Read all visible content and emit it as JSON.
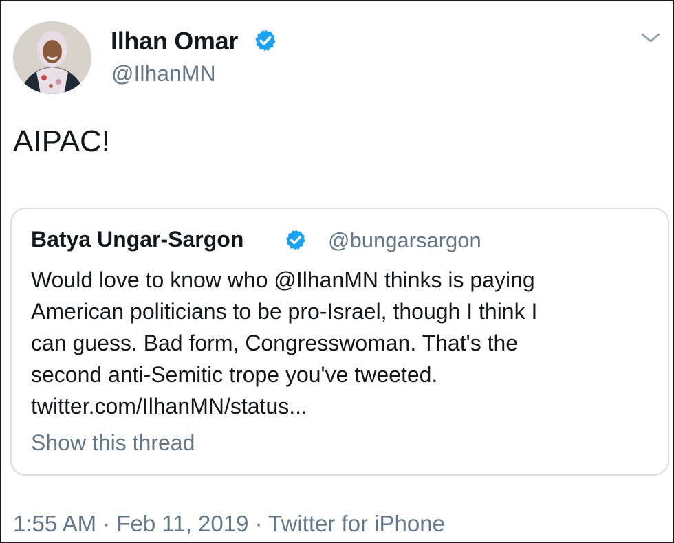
{
  "tweet": {
    "author_name": "Ilhan Omar",
    "author_handle": "@IlhanMN",
    "text": "AIPAC!",
    "meta": "1:55 AM · Feb 11, 2019 · Twitter for iPhone"
  },
  "quoted_tweet": {
    "author_name": "Batya Ungar-Sargon",
    "author_handle": "@bungarsargon",
    "lines": [
      "Would love to know who @IlhanMN thinks is paying",
      "American politicians to be pro-Israel, though I think I",
      "can guess. Bad form, Congresswoman. That's the",
      "second anti-Semitic trope you've tweeted.",
      "twitter.com/IlhanMN/status..."
    ],
    "thread_link": "Show this thread"
  },
  "icons": {
    "verified": "verified-badge-icon",
    "menu": "chevron-down-icon"
  },
  "colors": {
    "accent": "#1da1f2",
    "secondary_text": "#657786",
    "border": "#d8dee3"
  }
}
